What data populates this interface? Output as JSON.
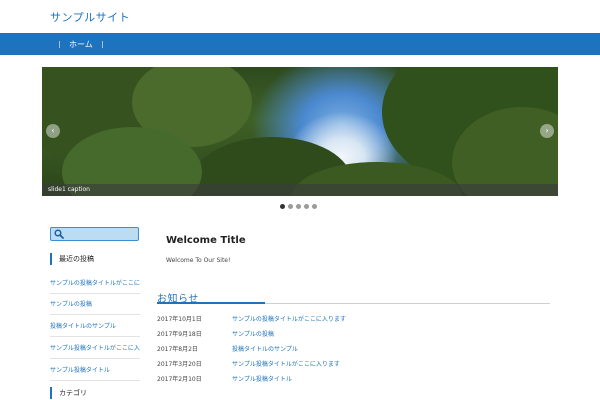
{
  "header": {
    "site_title": "サンプルサイト"
  },
  "nav": {
    "items": [
      {
        "label": "ホーム"
      }
    ]
  },
  "slider": {
    "caption": "slide1 caption",
    "prev_symbol": "‹",
    "next_symbol": "›",
    "slide_count": 5,
    "active_index": 0
  },
  "sidebar": {
    "search_placeholder": "",
    "sections": [
      {
        "heading": "最近の投稿",
        "links": [
          "サンプルの投稿タイトルがここに入ります",
          "サンプルの投稿",
          "投稿タイトルのサンプル",
          "サンプル投稿タイトルがここに入ります",
          "サンプル投稿タイトル"
        ]
      },
      {
        "heading": "カテゴリ",
        "links": []
      }
    ]
  },
  "main": {
    "welcome_title": "Welcome Title",
    "welcome_text": "Welcome To Our Site!",
    "news_heading": "お知らせ",
    "news": [
      {
        "date": "2017年10月1日",
        "title": "サンプルの投稿タイトルがここに入ります"
      },
      {
        "date": "2017年9月18日",
        "title": "サンプルの投稿"
      },
      {
        "date": "2017年8月2日",
        "title": "投稿タイトルのサンプル"
      },
      {
        "date": "2017年3月20日",
        "title": "サンプル投稿タイトルがここに入ります"
      },
      {
        "date": "2017年2月10日",
        "title": "サンプル投稿タイトル"
      }
    ]
  },
  "colors": {
    "brand": "#1e73be",
    "search_bg": "#bcdcf1"
  },
  "icons": {
    "search": "search-icon"
  }
}
